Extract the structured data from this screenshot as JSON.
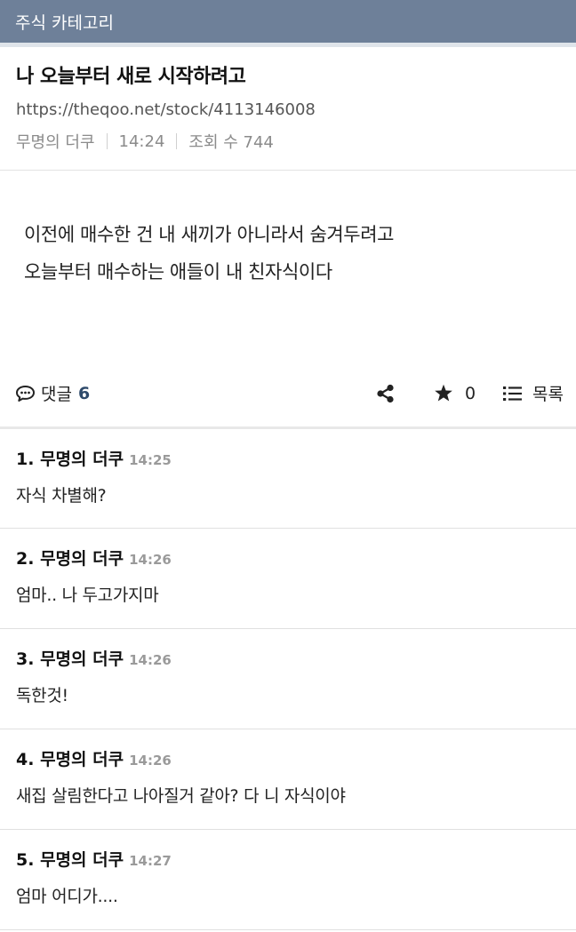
{
  "category": "주식 카테고리",
  "post": {
    "title": "나 오늘부터 새로 시작하려고",
    "url": "https://theqoo.net/stock/4113146008",
    "author": "무명의 더쿠",
    "time": "14:24",
    "views": "조회 수 744",
    "body": [
      "이전에 매수한 건 내 새끼가 아니라서 숨겨두려고",
      "오늘부터 매수하는 애들이 내 친자식이다"
    ]
  },
  "actions": {
    "comment_label": "댓글",
    "comment_count": "6",
    "star_count": "0",
    "list_label": "목록"
  },
  "comments": [
    {
      "num": "1.",
      "author": "무명의 더쿠",
      "time": "14:25",
      "text": "자식 차별해?"
    },
    {
      "num": "2.",
      "author": "무명의 더쿠",
      "time": "14:26",
      "text": "엄마.. 나 두고가지마"
    },
    {
      "num": "3.",
      "author": "무명의 더쿠",
      "time": "14:26",
      "text": "독한것!"
    },
    {
      "num": "4.",
      "author": "무명의 더쿠",
      "time": "14:26",
      "text": "새집 살림한다고 나아질거 같아? 다 니 자식이야"
    },
    {
      "num": "5.",
      "author": "무명의 더쿠",
      "time": "14:27",
      "text": "엄마 어디가...."
    }
  ],
  "icons": {
    "comment": "speech-bubble-icon",
    "share": "share-icon",
    "star": "star-icon",
    "list": "list-icon"
  },
  "colors": {
    "topbar": "#6e8099",
    "comment_count": "#2e4a6b"
  }
}
